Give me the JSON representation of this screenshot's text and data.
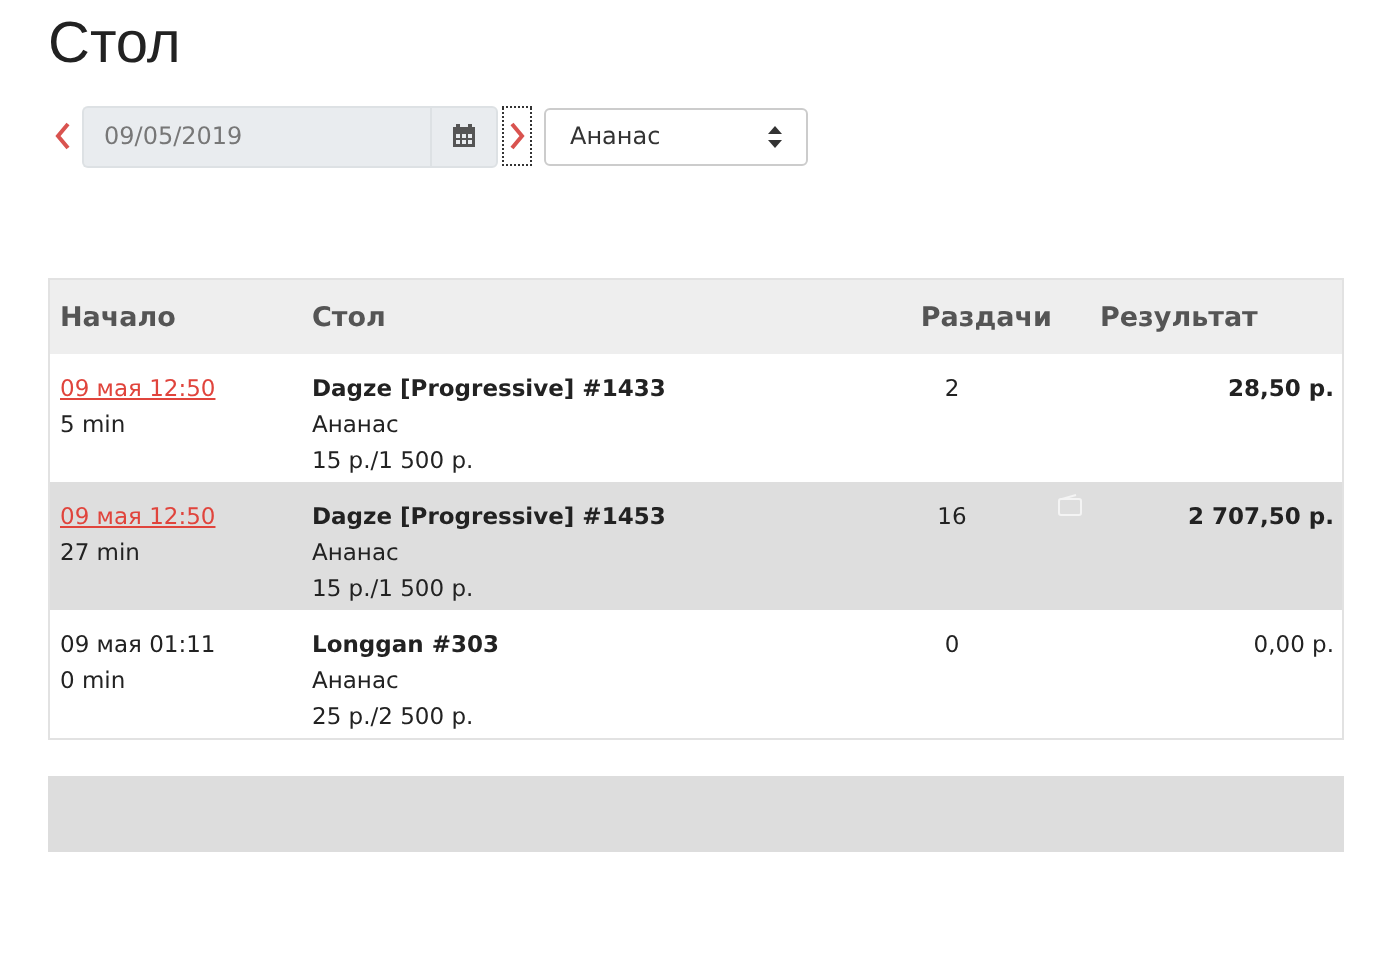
{
  "title": "Стол",
  "date_field": {
    "value": "09/05/2019"
  },
  "room_select": {
    "value": "Ананас"
  },
  "table": {
    "columns": [
      "Начало",
      "Стол",
      "Раздачи",
      "Результат"
    ],
    "rows": [
      {
        "start": "09 мая 12:50",
        "start_link": true,
        "duration": "5 min",
        "name": "Dagze [Progressive] #1433",
        "room": "Ананас",
        "stakes": "15 р./1 500 р.",
        "hands": "2",
        "result": "28,50 р.",
        "result_bold": true,
        "selected": false,
        "flagged": false
      },
      {
        "start": "09 мая 12:50",
        "start_link": true,
        "duration": "27 min",
        "name": "Dagze [Progressive] #1453",
        "room": "Ананас",
        "stakes": "15 р./1 500 р.",
        "hands": "16",
        "result": "2 707,50 р.",
        "result_bold": true,
        "selected": true,
        "flagged": true
      },
      {
        "start": "09 мая 01:11",
        "start_link": false,
        "duration": "0 min",
        "name": "Longgan #303",
        "room": "Ананас",
        "stakes": "25 р./2 500 р.",
        "hands": "0",
        "result": "0,00 р.",
        "result_bold": false,
        "selected": false,
        "flagged": false
      }
    ]
  }
}
